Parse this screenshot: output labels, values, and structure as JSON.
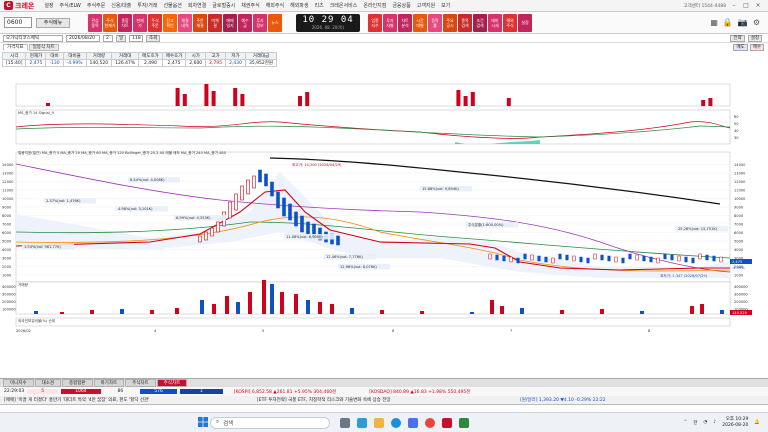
{
  "app": {
    "name": "크레온",
    "menu": [
      "설정",
      "주식/ELW",
      "주식주문",
      "신용/대출",
      "투자/거래",
      "선물옵션",
      "회차연결",
      "글로벌증시",
      "채권주식",
      "해외주식",
      "해외파생",
      "리츠",
      "크레온서비스",
      "온라인지점",
      "금융상품",
      "고객지원",
      "보기"
    ],
    "phone": "고객센터 1544-4488"
  },
  "toolbar": {
    "code": "0600",
    "menu_label": "주식메뉴",
    "tiles": [
      {
        "label": "관심\n종목",
        "color": "#d6336c"
      },
      {
        "label": "주식\n현재가",
        "color": "#e8590c"
      },
      {
        "label": "종합\n차트",
        "color": "#c2255c"
      },
      {
        "label": "현재\n가",
        "color": "#d6336c"
      },
      {
        "label": "주식\n주문",
        "color": "#e03131"
      },
      {
        "label": "잔고\n확인",
        "color": "#f76707"
      },
      {
        "label": "체결\n내역",
        "color": "#e64980"
      },
      {
        "label": "주문\n체결",
        "color": "#d9480f"
      },
      {
        "label": "미체\n결",
        "color": "#c92a2a"
      },
      {
        "label": "매매\n일지",
        "color": "#a61e4d"
      },
      {
        "label": "예수\n금",
        "color": "#c2255c"
      },
      {
        "label": "투자\n정보",
        "color": "#d6336c"
      },
      {
        "label": "뉴스",
        "color": "#e8590c"
      }
    ],
    "clock_time": "10 29 04",
    "clock_date": "2026. 08. 20(목)",
    "tiles2": [
      {
        "label": "업종\n지수",
        "color": "#e03131"
      },
      {
        "label": "투자\n자별",
        "color": "#d6336c"
      },
      {
        "label": "차트\n분석",
        "color": "#c2255c"
      },
      {
        "label": "시간\n대별",
        "color": "#e8590c"
      },
      {
        "label": "등락\n률",
        "color": "#e64980"
      },
      {
        "label": "주요\n공시",
        "color": "#d9480f"
      },
      {
        "label": "종목\n검색",
        "color": "#c92a2a"
      },
      {
        "label": "조건\n검색",
        "color": "#a61e4d"
      },
      {
        "label": "테마\n시세",
        "color": "#d6336c"
      },
      {
        "label": "해외\n주식",
        "color": "#e03131"
      },
      {
        "label": "설정",
        "color": "#c2255c"
      }
    ]
  },
  "query": {
    "field1": "오가닉티코스메틱",
    "field2": "2026/08/20",
    "field3": "2",
    "unit": "일",
    "count": "118",
    "button1": "조회",
    "right1": "전략",
    "right2": "설정",
    "right3": "매도",
    "right4": "매수"
  },
  "tabs": [
    "가격지표",
    "일봉식 차트"
  ],
  "info": {
    "headers": [
      "시각",
      "현재가",
      "대비",
      "대비율",
      "거래량",
      "거래대",
      "매도호가",
      "매수호가",
      "시가",
      "고가",
      "저가",
      "거래대금"
    ],
    "values": [
      "[15:40]",
      "2,475",
      "-130",
      "-4.99%",
      "140,520",
      "126.47%",
      "2,490",
      "2,475",
      "2,600",
      "2,795",
      "2,430",
      "35,952천원"
    ]
  },
  "chart_labels": {
    "volume_label": "거래량",
    "macd_label": "MS_종가 14  Signal_9",
    "price_legend": "일봉지표(일간) MA_종가 5  MA_종가 20  MA_종가 60  MA_종가 120  Bollinger_종가 20,2.00  매물  매도  MA_종가 240  MA_종가 480",
    "high_label": "최고가: 14,200 (2026/04/29)",
    "low_label": "최저가: 1,347 (2026/07/29)",
    "lower_label": "외국인보유비율(%) 순위",
    "annotations": [
      "6.44%(vol: 4,008K)",
      "15.88%(vol: 9,894K)",
      "2.37%(vol: 1,476K)",
      "4.98%(vol: 3,101K)",
      "6.99%(vol: 4,353K)",
      "11.08%(vol: 6,900K)",
      "25.28%(vol: 15,751K)",
      "1.54%(vol: 961.77K)",
      "12.46%(vol: 7,776K)",
      "12.96%(vol: 8,076K)",
      "주식분할(1:600.00%)"
    ],
    "x_labels": [
      "2026/02",
      "4",
      "5",
      "6",
      "7",
      "8"
    ],
    "y_price": [
      "14000",
      "13000",
      "12000",
      "11000",
      "10000",
      "9000",
      "8000",
      "7000",
      "6000",
      "5000",
      "4000",
      "3000",
      "2000",
      "1000"
    ],
    "y_vol": [
      "400000",
      "300000",
      "200000",
      "100000"
    ],
    "y_macd": [
      "60",
      "50",
      "40",
      "30"
    ],
    "price_tag": "2,475",
    "price_pct": "-4.99%",
    "vol_tag": "140,520"
  },
  "bottom_tabs": [
    "미니지수",
    "대소견",
    "종합합판",
    "복기차트",
    "주식차트",
    "주식차트"
  ],
  "ticker1": {
    "time": "22:29:03",
    "v1": "5",
    "v2": "1064",
    "v3": "86",
    "v4": "576",
    "v5": "1",
    "kospi": "[KOSPI] 6,852.58 ▲261.81 +5.95% 304,460천",
    "kosdaq": "[KOSDAQ] 840.89 ▲16.83 +1.98% 550,495천"
  },
  "ticker2": {
    "news1": "[매매] '미끌 게 터졌다' 홍만기 '대더트 특약 '4만 꿈잠' 의료, 펀도 '할닥 선관'",
    "news2": "[ETF 투자전략] 국풍 ETF, 지정학적 리스크와 기술변화 속에 상승 전망",
    "usd": "[원/달러] 1,393.20 ▼4.10 -0.29% 22:22"
  },
  "taskbar": {
    "search": "검색",
    "time": "오후 10:29",
    "date": "2026-08-20",
    "lang": "한"
  },
  "colors": {
    "brand": "#c8102e",
    "up": "#d1001c",
    "down": "#0b52c9"
  }
}
